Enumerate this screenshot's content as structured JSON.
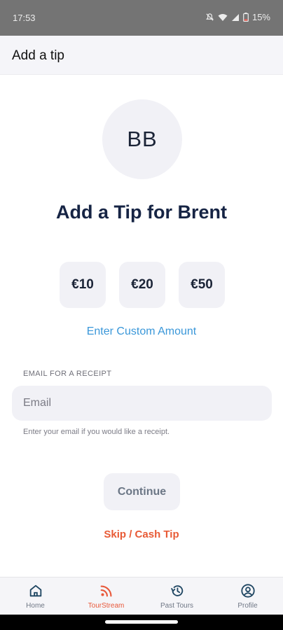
{
  "status_bar": {
    "time": "17:53",
    "battery": "15%",
    "icons": [
      "mute-icon",
      "wifi-icon",
      "signal-icon",
      "battery-icon"
    ]
  },
  "header": {
    "title": "Add a tip"
  },
  "guide": {
    "initials": "BB"
  },
  "main": {
    "title": "Add a Tip for Brent",
    "amounts": [
      "€10",
      "€20",
      "€50"
    ],
    "custom_amount_label": "Enter Custom Amount",
    "email_label": "EMAIL FOR A RECEIPT",
    "email_placeholder": "Email",
    "email_value": "",
    "email_help": "Enter your email if you would like a receipt.",
    "continue_label": "Continue",
    "skip_label": "Skip / Cash Tip"
  },
  "bottom_nav": {
    "items": [
      {
        "label": "Home",
        "icon": "home-icon",
        "active": false
      },
      {
        "label": "TourStream",
        "icon": "rss-icon",
        "active": true
      },
      {
        "label": "Past Tours",
        "icon": "history-icon",
        "active": false
      },
      {
        "label": "Profile",
        "icon": "profile-icon",
        "active": false
      }
    ]
  },
  "colors": {
    "accent": "#e8583a",
    "link": "#3a97d9",
    "title": "#162444",
    "surface": "#f1f1f6"
  }
}
